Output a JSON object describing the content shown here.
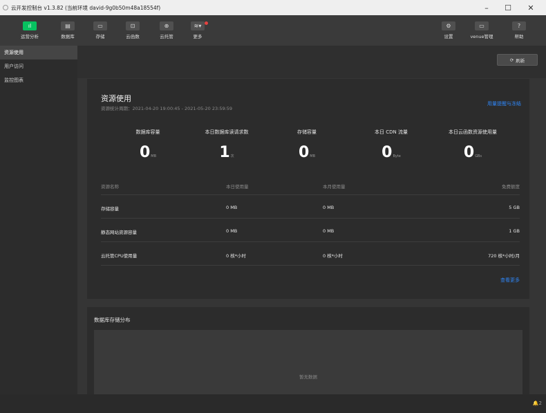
{
  "window": {
    "title": "云开发控制台 v1.3.82 (当前环境 david-9g0b50m48a18554f)",
    "minimize": "–",
    "maximize": "☐",
    "close": "✕"
  },
  "toolbar": {
    "left": [
      {
        "label": "运营分析",
        "icon": "chart-icon",
        "glyph": "ıl",
        "active": true
      },
      {
        "label": "数据库",
        "icon": "database-icon",
        "glyph": "▤"
      },
      {
        "label": "存储",
        "icon": "storage-icon",
        "glyph": "▭"
      },
      {
        "label": "云函数",
        "icon": "function-icon",
        "glyph": "⊡"
      },
      {
        "label": "云托管",
        "icon": "cloud-hosting-icon",
        "glyph": "⊕"
      },
      {
        "label": "更多",
        "icon": "more-icon",
        "glyph": "≋▾"
      }
    ],
    "right": [
      {
        "label": "设置",
        "icon": "gear-icon",
        "glyph": "⚙"
      },
      {
        "label": "venue管理",
        "icon": "venue-icon",
        "glyph": "▭"
      },
      {
        "label": "帮助",
        "icon": "help-icon",
        "glyph": "?"
      }
    ]
  },
  "sidebar": {
    "items": [
      {
        "label": "资源使用",
        "active": true
      },
      {
        "label": "用户访问"
      },
      {
        "label": "监控图表"
      }
    ]
  },
  "main": {
    "refresh_label": "刷新",
    "card": {
      "title": "资源使用",
      "subtitle": "资源统计周期：2021-04-20 19:00:45 - 2021-05-20 23:59:59",
      "link": "用量提醒与冻结",
      "stats": [
        {
          "label": "数据库容量",
          "value": "0",
          "unit": "MB"
        },
        {
          "label": "本日数据库读请求数",
          "value": "1",
          "unit": "次"
        },
        {
          "label": "存储容量",
          "value": "0",
          "unit": "MB"
        },
        {
          "label": "本日 CDN 流量",
          "value": "0",
          "unit": "Byte"
        },
        {
          "label": "本日云函数资源使用量",
          "value": "0",
          "unit": "GBs"
        }
      ],
      "table": {
        "headers": [
          "资源名称",
          "本日使用量",
          "本月使用量",
          "免费额度"
        ],
        "rows": [
          [
            "存储容量",
            "0 MB",
            "0 MB",
            "5 GB"
          ],
          [
            "静态网站资源容量",
            "0 MB",
            "0 MB",
            "1 GB"
          ],
          [
            "云托管CPU使用量",
            "0 核*小时",
            "0 核*小时",
            "720 核*小时/月"
          ]
        ]
      },
      "more_link": "查看更多"
    },
    "db_card": {
      "title": "数据库存储分布",
      "empty": "暂无数据"
    }
  },
  "statusbar": {
    "bell": "🔔2"
  }
}
